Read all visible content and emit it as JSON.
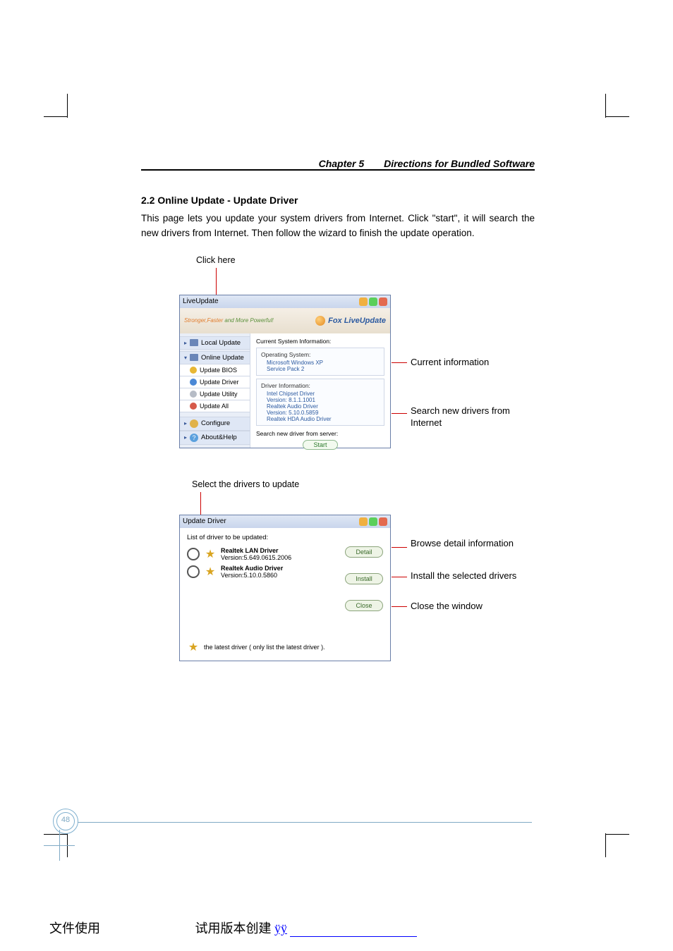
{
  "chapter": {
    "num_label": "Chapter 5",
    "title": "Directions for Bundled Software"
  },
  "section": {
    "title": "2.2 Online Update - Update Driver",
    "body": "This page lets you update your system drivers from Internet. Click \"start\", it will search the new drivers from Internet. Then follow the wizard to finish the update operation."
  },
  "fig1": {
    "click_here": "Click here",
    "window_title": "LiveUpdate",
    "tagline_a": "Stronger,Faster",
    "tagline_b": " and More Powerful!",
    "brand": "Fox LiveUpdate",
    "sidebar": {
      "local_update": "Local Update",
      "online_update": "Online Update",
      "update_bios": "Update BIOS",
      "update_driver": "Update Driver",
      "update_utility": "Update Utility",
      "update_all": "Update All",
      "configure": "Configure",
      "about_help": "About&Help"
    },
    "main": {
      "heading": "Current System Information:",
      "os_title": "Operating System:",
      "os_line1": "Microsoft Windows XP",
      "os_line2": "Service Pack 2",
      "drv_title": "Driver Information:",
      "drv_line1": "Intel Chipset Driver",
      "drv_line2": "Version: 8.1.1.1001",
      "drv_line3": "Realtek Audio Driver",
      "drv_line4": "Version: 5.10.0.5859",
      "drv_line5": "Realtek HDA Audio Driver",
      "search_label": "Search new driver from server:",
      "start": "Start"
    },
    "callout_info": "Current information",
    "callout_search": "Search new drivers from Internet"
  },
  "fig2": {
    "select_label": "Select the drivers to update",
    "window_title": "Update Driver",
    "list_label": "List of driver to be updated:",
    "drivers": [
      {
        "name": "Realtek LAN Driver",
        "version": "Version:5.649.0615.2006"
      },
      {
        "name": "Realtek Audio Driver",
        "version": "Version:5.10.0.5860"
      }
    ],
    "legend": "the latest driver ( only list the latest driver ).",
    "buttons": {
      "detail": "Detail",
      "install": "Install",
      "close": "Close"
    },
    "callout_detail": "Browse detail information",
    "callout_install": "Install the selected drivers",
    "callout_close": "Close the window"
  },
  "page_number": "48",
  "footer": {
    "left": "文件使用",
    "mid": " 试用版本创建 ",
    "link": "ÿÿ"
  }
}
